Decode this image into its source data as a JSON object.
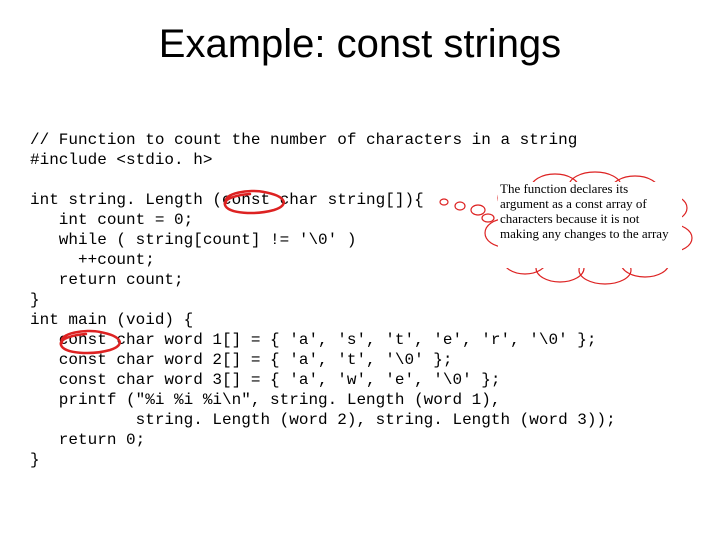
{
  "title": "Example: const strings",
  "code_lines": {
    "l0": "// Function to count the number of characters in a string",
    "l1": "#include <stdio. h>",
    "l2": "",
    "l3": "int string. Length (const char string[]){",
    "l4": "   int count = 0;",
    "l5": "   while ( string[count] != '\\0' )",
    "l6": "     ++count;",
    "l7": "   return count;",
    "l8": "}",
    "l9": "int main (void) {",
    "l10": "   const char word 1[] = { 'a', 's', 't', 'e', 'r', '\\0' };",
    "l11": "   const char word 2[] = { 'a', 't', '\\0' };",
    "l12": "   const char word 3[] = { 'a', 'w', 'e', '\\0' };",
    "l13": "   printf (\"%i %i %i\\n\", string. Length (word 1),",
    "l14": "           string. Length (word 2), string. Length (word 3));",
    "l15": "   return 0;",
    "l16": "}"
  },
  "annotation": {
    "text": "The function declares its argument as a const array of characters because it is not making any changes to the array"
  },
  "colors": {
    "scribble": "#d22",
    "cloud_stroke": "#d22"
  }
}
